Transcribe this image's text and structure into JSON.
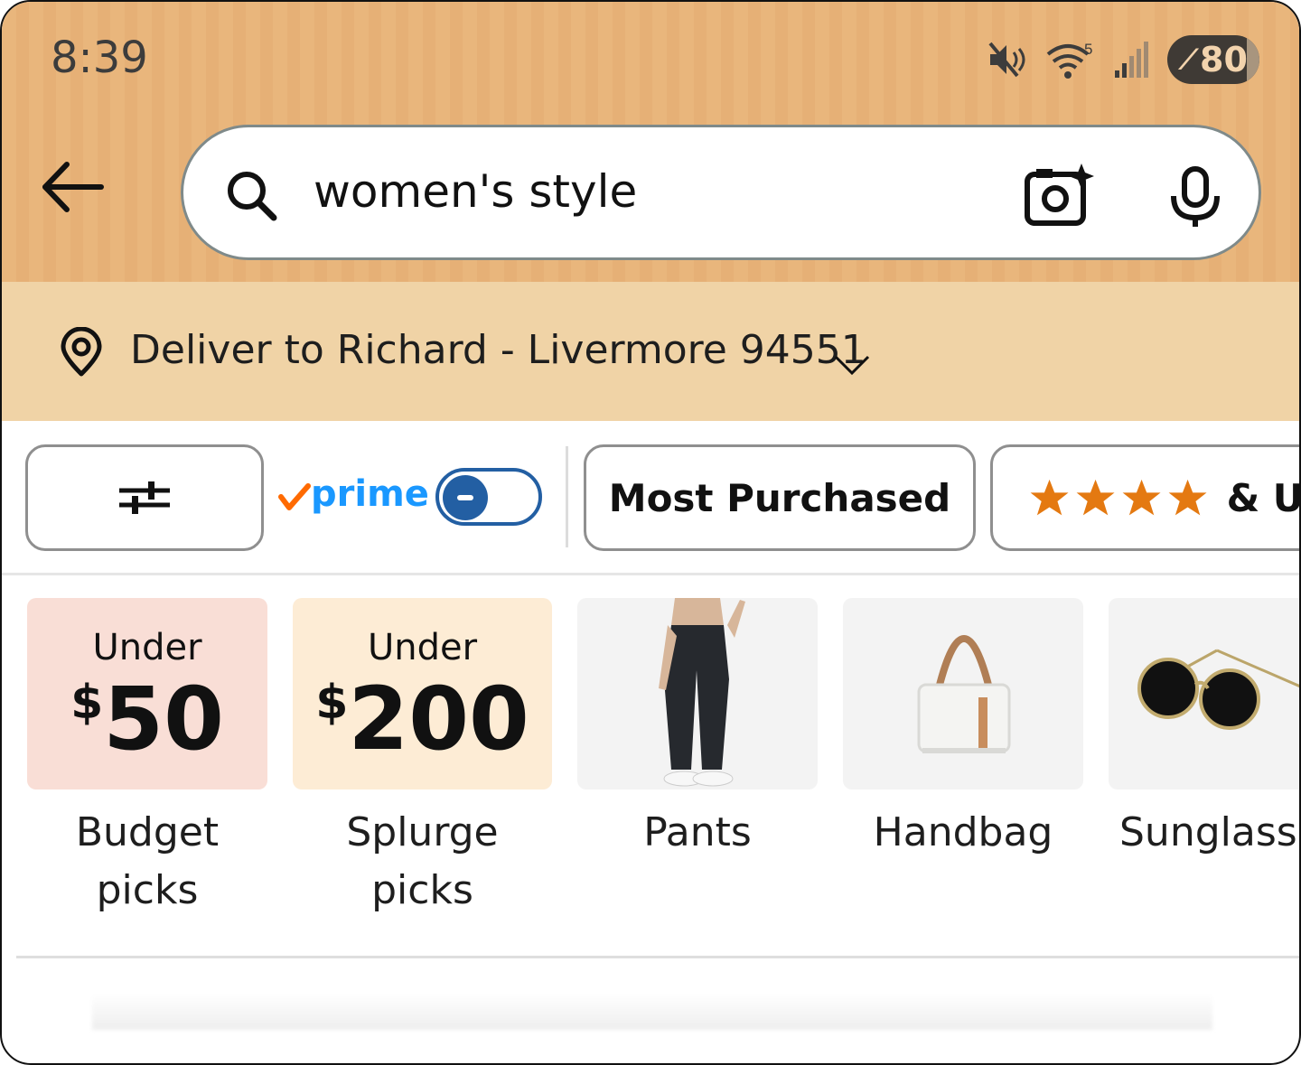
{
  "status_bar": {
    "time": "8:39",
    "wifi_badge": "5",
    "battery_level": "80",
    "icons": [
      "mute-icon",
      "wifi-icon",
      "signal-icon",
      "battery-saver-icon"
    ]
  },
  "search": {
    "query": "women's style",
    "icons": [
      "back-arrow-icon",
      "search-icon",
      "camera-icon",
      "microphone-icon"
    ]
  },
  "delivery": {
    "text": "Deliver to Richard - Livermore 94551"
  },
  "filters": {
    "prime_label": "prime",
    "prime_toggle_on": false,
    "most_purchased_label": "Most Purchased",
    "rating_stars": 4,
    "rating_suffix": "& Up"
  },
  "categories": [
    {
      "under_label": "Under",
      "currency": "$",
      "amount": "50",
      "label_line1": "Budget",
      "label_line2": "picks",
      "color": "#f9ded6"
    },
    {
      "under_label": "Under",
      "currency": "$",
      "amount": "200",
      "label_line1": "Splurge",
      "label_line2": "picks",
      "color": "#fdecd5"
    },
    {
      "label_line1": "Pants",
      "image": "pants"
    },
    {
      "label_line1": "Handbag",
      "image": "handbag"
    },
    {
      "label_line1": "Sunglasses",
      "image": "sunglasses"
    }
  ],
  "colors": {
    "header_bg": "#e9b67c",
    "deliver_bg": "#f0d3a6",
    "prime_blue": "#1a98ff",
    "prime_check": "#ff6a00",
    "toggle_blue": "#235fa3",
    "star_orange": "#e47911"
  }
}
